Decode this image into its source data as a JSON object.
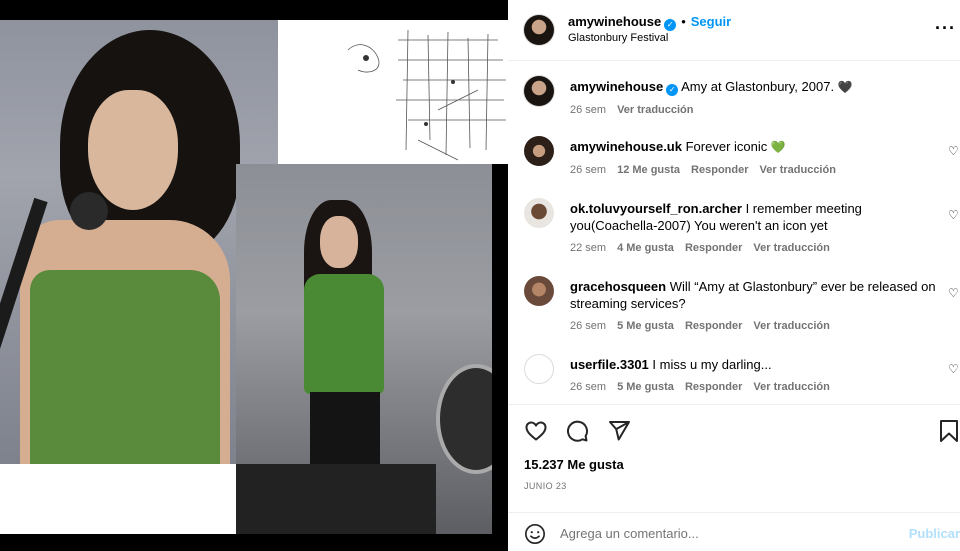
{
  "header": {
    "username": "amywinehouse",
    "follow_label": "Seguir",
    "location": "Glastonbury Festival",
    "more_icon": "more-icon"
  },
  "caption": {
    "username": "amywinehouse",
    "text": "Amy at Glastonbury, 2007.",
    "emoji": "🖤",
    "time": "26 sem",
    "translate": "Ver traducción"
  },
  "comments": [
    {
      "username": "amywinehouse.uk",
      "text": "Forever iconic",
      "emoji": "💚",
      "time": "26 sem",
      "likes": "12 Me gusta",
      "reply": "Responder",
      "translate": "Ver traducción"
    },
    {
      "username": "ok.toluvyourself_ron.archer",
      "text": "I remember meeting you(Coachella-2007) You weren't an icon yet",
      "emoji": "",
      "time": "22 sem",
      "likes": "4 Me gusta",
      "reply": "Responder",
      "translate": "Ver traducción"
    },
    {
      "username": "gracehosqueen",
      "text": "Will “Amy at Glastonbury” ever be released on streaming services?",
      "emoji": "",
      "time": "26 sem",
      "likes": "5 Me gusta",
      "reply": "Responder",
      "translate": "Ver traducción"
    },
    {
      "username": "userfile.3301",
      "text": "I miss u my darling...",
      "emoji": "",
      "time": "26 sem",
      "likes": "5 Me gusta",
      "reply": "Responder",
      "translate": "Ver traducción"
    }
  ],
  "actions": {
    "likes": "15.237 Me gusta",
    "date": "JUNIO 23"
  },
  "composer": {
    "placeholder": "Agrega un comentario...",
    "post_label": "Publicar"
  },
  "colors": {
    "link": "#0095f6",
    "muted": "#737373",
    "publish_disabled": "#b2dffc"
  }
}
